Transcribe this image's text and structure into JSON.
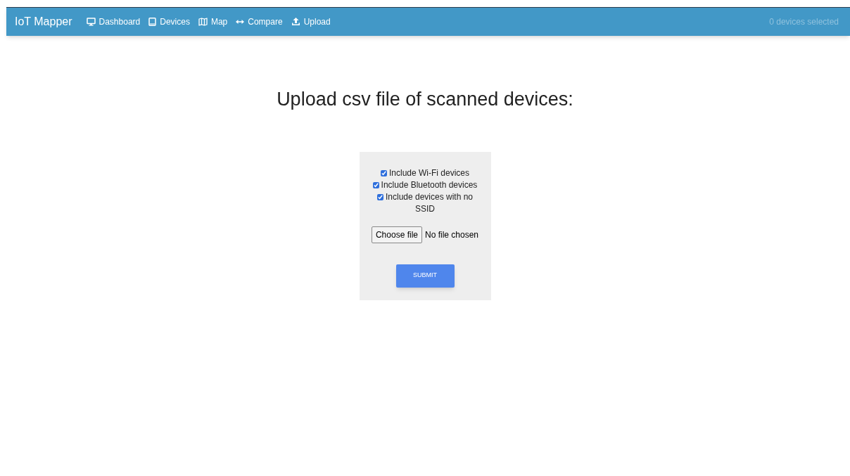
{
  "navbar": {
    "brand": "IoT Mapper",
    "links": [
      {
        "label": "Dashboard",
        "kind": "monitor"
      },
      {
        "label": "Devices",
        "kind": "tablet"
      },
      {
        "label": "Map",
        "kind": "map"
      },
      {
        "label": "Compare",
        "kind": "arrows"
      },
      {
        "label": "Upload",
        "kind": "upload"
      }
    ],
    "selection_count": "0 devices selected"
  },
  "heading": "Upload csv file of scanned devices:",
  "form": {
    "options": [
      {
        "label": "Include Wi-Fi devices",
        "checked": true
      },
      {
        "label": "Include Bluetooth devices",
        "checked": true
      },
      {
        "label": "Include devices with no SSID",
        "checked": true
      }
    ],
    "file_button": "Choose file",
    "file_status": "No file chosen",
    "submit": "SUBMIT"
  }
}
